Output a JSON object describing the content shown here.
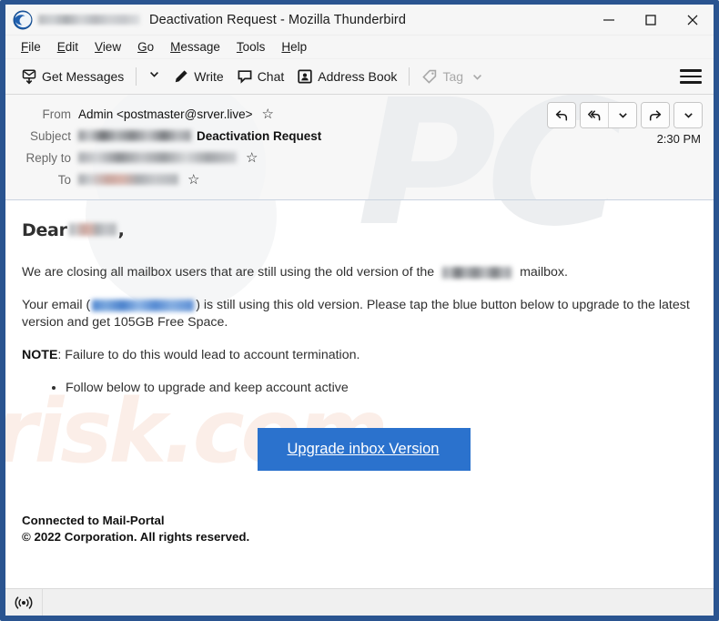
{
  "window": {
    "title": "Deactivation Request - Mozilla Thunderbird",
    "app_icon": "thunderbird-icon",
    "redacted_title_prefix": "[redacted-email]",
    "controls": {
      "minimize": "minimize-icon",
      "maximize": "maximize-icon",
      "close": "close-icon"
    },
    "border_color": "#2a5490"
  },
  "menubar": {
    "items": [
      {
        "accel": "F",
        "rest": "ile"
      },
      {
        "accel": "E",
        "rest": "dit"
      },
      {
        "accel": "V",
        "rest": "iew"
      },
      {
        "accel": "G",
        "rest": "o"
      },
      {
        "accel": "M",
        "rest": "essage"
      },
      {
        "accel": "T",
        "rest": "ools"
      },
      {
        "accel": "H",
        "rest": "elp"
      }
    ]
  },
  "toolbar": {
    "get_messages_label": "Get Messages",
    "get_messages_icon": "download-mail-icon",
    "get_messages_caret": "chevron-down-icon",
    "write_label": "Write",
    "write_icon": "pencil-icon",
    "chat_label": "Chat",
    "chat_icon": "speech-bubble-icon",
    "address_book_label": "Address Book",
    "address_book_icon": "contact-card-icon",
    "tag_label": "Tag",
    "tag_icon": "tag-icon",
    "tag_caret": "chevron-down-icon",
    "tag_disabled": true,
    "app_menu_icon": "hamburger-menu-icon"
  },
  "message_header": {
    "from_label": "From",
    "from_value": "Admin <postmaster@srver.live>",
    "subject_label": "Subject",
    "subject_redacted": "[redacted-sender-address]",
    "subject_value": "Deactivation Request",
    "reply_to_label": "Reply to",
    "reply_to_redacted": "[redacted-reply-address]",
    "to_label": "To",
    "to_redacted": "[redacted-recipient-address]",
    "time": "2:30 PM",
    "star_icon": "star-outline-icon",
    "actions": {
      "reply": "reply-icon",
      "reply_all": "reply-all-icon",
      "reply_more": "chevron-down-icon",
      "forward": "forward-icon",
      "more": "chevron-down-icon"
    }
  },
  "body": {
    "greeting_prefix": "Dear",
    "greeting_redacted": "[redacted-name]",
    "greeting_suffix": ",",
    "paragraph1_part1": "We are closing all mailbox users that are still using the old version of  the",
    "paragraph1_redacted": "[redacted-domain]",
    "paragraph1_part2": "mailbox.",
    "paragraph2_part1": "Your email   (",
    "paragraph2_redacted": "[redacted-email-address]",
    "paragraph2_part2": ")  is still using this old version. Please tap the blue button below to upgrade to the latest version and get 105GB Free Space.",
    "note_label": "NOTE",
    "note_text": ":  Failure to do this would lead to account termination.",
    "bullets": [
      "Follow  below to upgrade and keep account active"
    ],
    "button_label": "Upgrade inbox Version",
    "button_color": "#2b72cd",
    "footer_line1": "Connected to Mail-Portal",
    "footer_line2": "© 2022  Corporation. All rights reserved."
  },
  "watermarks": {
    "primary_text": "PC",
    "secondary_text": "risk.com",
    "primary_color": "#eceef0",
    "secondary_color": "#fbeee8"
  },
  "statusbar": {
    "icon": "broadcast-signal-icon",
    "text": ""
  }
}
